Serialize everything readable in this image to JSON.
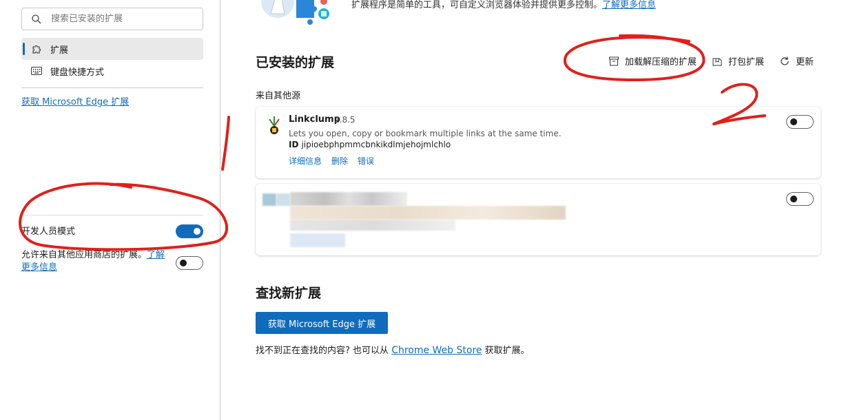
{
  "sidebar": {
    "search_placeholder": "搜索已安装的扩展",
    "nav": [
      {
        "label": "扩展",
        "icon": "puzzle-icon",
        "selected": true
      },
      {
        "label": "键盘快捷方式",
        "icon": "keyboard-icon",
        "selected": false
      }
    ],
    "get_extensions_link": "获取 Microsoft Edge 扩展",
    "developer_mode": {
      "label": "开发人员模式",
      "enabled": true
    },
    "allow_other_stores": {
      "text": "允许来自其他应用商店的扩展。",
      "link": "了解更多信息",
      "enabled": false
    }
  },
  "main": {
    "intro_text": "扩展程序是简单的工具，可自定义浏览器体验并提供更多控制。",
    "intro_link": "了解更多信息",
    "installed_title": "已安装的扩展",
    "actions": [
      {
        "label": "加载解压缩的扩展",
        "icon": "archive-icon"
      },
      {
        "label": "打包扩展",
        "icon": "package-icon"
      },
      {
        "label": "更新",
        "icon": "refresh-icon"
      }
    ],
    "source_label": "来自其他源",
    "extensions": [
      {
        "name": "Linkclump",
        "version": "2.8.5",
        "description": "Lets you open, copy or bookmark multiple links at the same time.",
        "id_label": "ID",
        "id": "jipioebphpmmcbnkikdlmjehojmlchlo",
        "links": [
          "详细信息",
          "删除",
          "错误"
        ],
        "enabled": false
      },
      {
        "name": "",
        "redacted": true,
        "enabled": false
      }
    ],
    "find_title": "查找新扩展",
    "get_button": "获取 Microsoft Edge 扩展",
    "footer_text": "找不到正在查找的内容? 也可以从",
    "footer_link": "Chrome Web Store",
    "footer_suffix": "获取扩展。"
  },
  "annotations": {
    "color": "#e0201b",
    "labels": [
      "1",
      "2"
    ]
  },
  "colors": {
    "accent": "#0f6cbd",
    "annotation_red": "#e0201b"
  }
}
